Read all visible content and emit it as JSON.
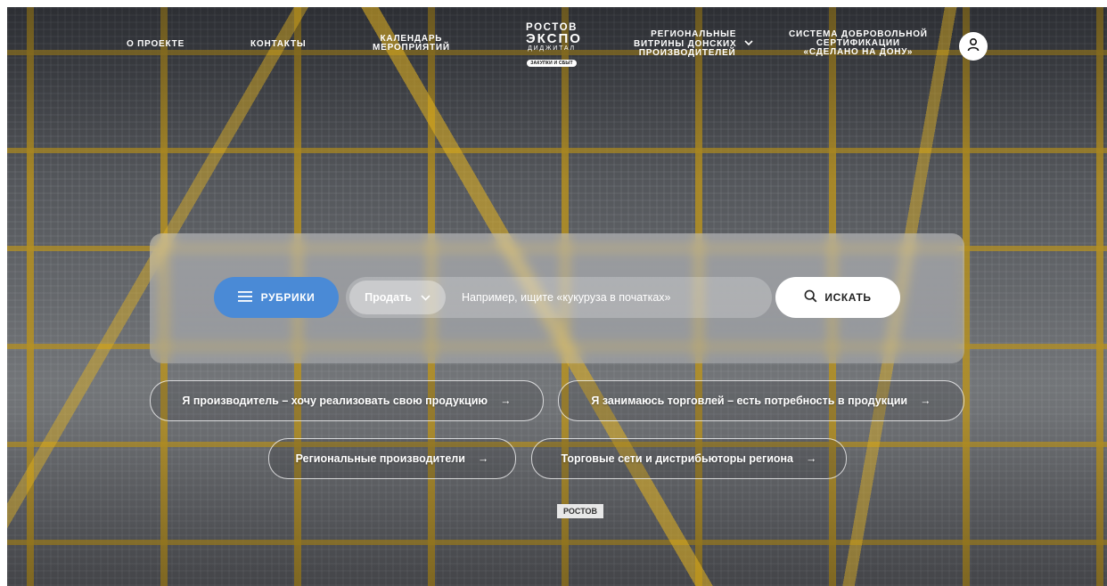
{
  "nav": {
    "about": "О ПРОЕКТЕ",
    "contacts": "КОНТАКТЫ",
    "calendar_line1": "КАЛЕНДАРЬ",
    "calendar_line2": "МЕРОПРИЯТИЙ",
    "showcases_line1": "РЕГИОНАЛЬНЫЕ",
    "showcases_line2": "ВИТРИНЫ ДОНСКИХ",
    "showcases_line3": "ПРОИЗВОДИТЕЛЕЙ",
    "cert_line1": "СИСТЕМА ДОБРОВОЛЬНОЙ",
    "cert_line2": "СЕРТИФИКАЦИИ",
    "cert_line3": "«СДЕЛАНО НА ДОНУ»"
  },
  "logo": {
    "line1": "РОСТОВ",
    "line2": "ЭКСПО",
    "line3": "ДИДЖИТАЛ",
    "tag": "ЗАКУПКИ И СБЫТ"
  },
  "search": {
    "rubrics_label": "РУБРИКИ",
    "mode_selected": "Продать",
    "placeholder": "Например, ищите «кукуруза в початках»",
    "submit_label": "ИСКАТЬ"
  },
  "actions": {
    "producer": "Я производитель – хочу реализовать свою продукцию",
    "trader": "Я занимаюсь торговлей – есть потребность в продукции",
    "regional": "Региональные производители",
    "retail": "Торговые сети и дистрибьюторы региона",
    "arrow": "→"
  },
  "background": {
    "sign_text": "РОСТОВ"
  },
  "colors": {
    "accent": "#4a8ad6",
    "text_light": "#ffffff"
  }
}
